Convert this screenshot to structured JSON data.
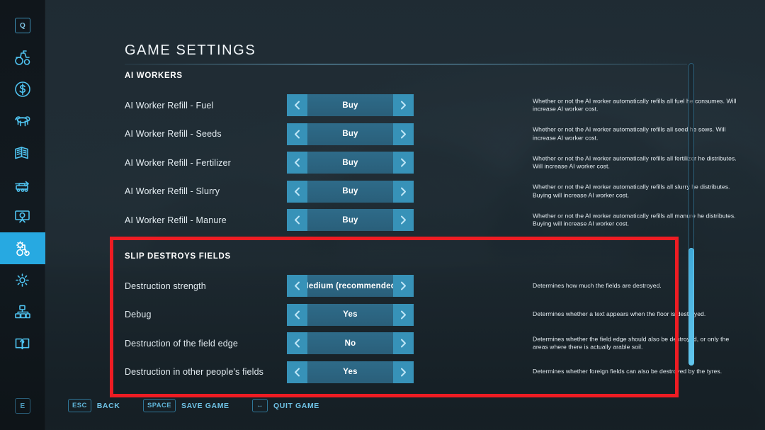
{
  "sidebar": {
    "top_key": "Q",
    "bottom_key": "E",
    "items": [
      {
        "icon": "tractor-icon",
        "name": "sidebar-item-vehicles",
        "active": false
      },
      {
        "icon": "dollar-circle-icon",
        "name": "sidebar-item-finances",
        "active": false
      },
      {
        "icon": "cow-icon",
        "name": "sidebar-item-animals",
        "active": false
      },
      {
        "icon": "contracts-icon",
        "name": "sidebar-item-contracts",
        "active": false
      },
      {
        "icon": "production-icon",
        "name": "sidebar-item-production",
        "active": false
      },
      {
        "icon": "map-overview-icon",
        "name": "sidebar-item-map",
        "active": false
      },
      {
        "icon": "tractor-gear-icon",
        "name": "sidebar-item-game-settings",
        "active": true
      },
      {
        "icon": "gear-icon",
        "name": "sidebar-item-general-settings",
        "active": false
      },
      {
        "icon": "multiplayer-icon",
        "name": "sidebar-item-multiplayer",
        "active": false
      },
      {
        "icon": "help-book-icon",
        "name": "sidebar-item-help",
        "active": false
      }
    ]
  },
  "header": {
    "title": "GAME SETTINGS"
  },
  "sections": [
    {
      "heading": "AI WORKERS",
      "rows": [
        {
          "label": "AI Worker Refill - Fuel",
          "value": "Buy",
          "description": "Whether or not the AI worker automatically refills all fuel he consumes. Will increase AI worker cost."
        },
        {
          "label": "AI Worker Refill - Seeds",
          "value": "Buy",
          "description": "Whether or not the AI worker automatically refills all seed he sows. Will increase AI worker cost."
        },
        {
          "label": "AI Worker Refill - Fertilizer",
          "value": "Buy",
          "description": "Whether or not the AI worker automatically refills all fertilizer he distributes. Will increase AI worker cost."
        },
        {
          "label": "AI Worker Refill - Slurry",
          "value": "Buy",
          "description": "Whether or not the AI worker automatically refills all slurry he distributes. Buying will increase AI worker cost."
        },
        {
          "label": "AI Worker Refill - Manure",
          "value": "Buy",
          "description": "Whether or not the AI worker automatically refills all manure he distributes. Buying will increase AI worker cost."
        }
      ]
    },
    {
      "heading": "SLIP DESTROYS FIELDS",
      "highlighted": true,
      "rows": [
        {
          "label": "Destruction strength",
          "value": "Medium (recommended)",
          "description": "Determines how much the fields are destroyed."
        },
        {
          "label": "Debug",
          "value": "Yes",
          "description": "Determines whether a text appears when the floor is destroyed."
        },
        {
          "label": "Destruction of the field edge",
          "value": "No",
          "description": "Determines whether the field edge should also be destroyed, or only the areas where there is actually arable soil."
        },
        {
          "label": "Destruction in other people's fields",
          "value": "Yes",
          "description": "Determines whether foreign fields can also be destroyed by the tyres."
        }
      ]
    }
  ],
  "footer": {
    "actions": [
      {
        "key": "ESC",
        "label": "BACK",
        "name": "footer-back"
      },
      {
        "key": "SPACE",
        "label": "SAVE GAME",
        "name": "footer-save-game"
      },
      {
        "key": "↔",
        "label": "QUIT GAME",
        "name": "footer-quit-game"
      }
    ]
  },
  "colors": {
    "accent": "#27a9e1",
    "selector_arrow": "#3792b8",
    "selector_body": "#2d6480",
    "highlight_box": "#ee1c23",
    "panel_bg": "#27333a"
  }
}
